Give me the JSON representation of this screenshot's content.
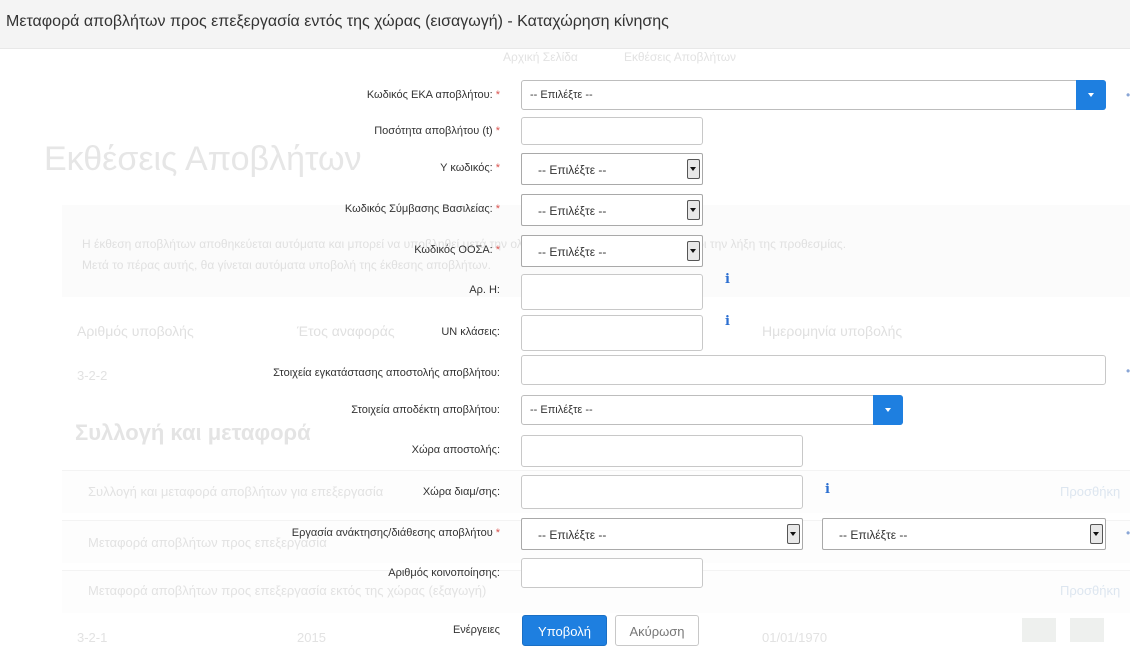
{
  "title": "Μεταφορά αποβλήτων προς επεξεργασία εντός της χώρας (εισαγωγή) - Καταχώρηση κίνησης",
  "background": {
    "nav_items": [
      "Αρχική Σελίδα",
      "Εκθέσεις Αποβλήτων"
    ],
    "heading": "Εκθέσεις Αποβλήτων",
    "notice_line1": "Η έκθεση αποβλήτων αποθηκεύεται αυτόματα και μπορεί να υποβληθεί μετά την ολοκλήρωση της καταχώρησης μέχρι την λήξη της προθεσμίας.",
    "notice_line2": "Μετά το πέρας αυτής, θα γίνεται αυτόματα υποβολή της έκθεσης αποβλήτων.",
    "table_headers": [
      "Αριθμός υποβολής",
      "Έτος αναφοράς",
      "Ημερομηνία υποβολής"
    ],
    "row1_code": "3-2-2",
    "section_heading": "Συλλογή και μεταφορά",
    "rows": [
      "Συλλογή και μεταφορά αποβλήτων για επεξεργασία",
      "Μεταφορά αποβλήτων προς επεξεργασία",
      "Μεταφορά αποβλήτων προς επεξεργασία εκτός της χώρας (εξαγωγή)"
    ],
    "row_link": "Προσθήκη",
    "last_row_code": "3-2-1",
    "last_row_year": "2015",
    "last_row_date": "01/01/1970"
  },
  "form": {
    "eka_label": "Κωδικός ΕΚΑ αποβλήτου:",
    "eka_value": "-- Επιλέξτε --",
    "quantity_label": "Ποσότητα αποβλήτου (t)",
    "quantity_value": "",
    "y_code_label": "Υ κωδικός:",
    "y_code_value": "-- Επιλέξτε --",
    "basel_label": "Κωδικός Σύμβασης Βασιλείας:",
    "basel_value": "-- Επιλέξτε --",
    "oecd_label": "Κωδικός ΟΟΣΑ:",
    "oecd_value": "-- Επιλέξτε --",
    "h_number_label": "Αρ. Η:",
    "h_number_value": "",
    "un_label": "UN κλάσεις:",
    "un_value": "",
    "facility_label": "Στοιχεία εγκατάστασης αποστολής αποβλήτου:",
    "facility_value": "",
    "recipient_label": "Στοιχεία αποδέκτη αποβλήτου:",
    "recipient_value": "-- Επιλέξτε --",
    "origin_label": "Χώρα αποστολής:",
    "origin_value": "",
    "transit_label": "Χώρα διαμ/σης:",
    "transit_value": "",
    "operation_label": "Εργασία ανάκτησης/διάθεσης αποβλήτου",
    "operation_value_1": "-- Επιλέξτε --",
    "operation_value_2": "-- Επιλέξτε --",
    "notification_label": "Αριθμός κοινοποίησης:",
    "notification_value": "",
    "actions_label": "Ενέργειες",
    "submit_label": "Υποβολή",
    "cancel_label": "Ακύρωση",
    "required_mark": "*",
    "info_glyph": "i",
    "edge_glyph": "•"
  },
  "colors": {
    "primary": "#1e7fe0",
    "required": "#d9534f",
    "info": "#2c6fd1"
  }
}
